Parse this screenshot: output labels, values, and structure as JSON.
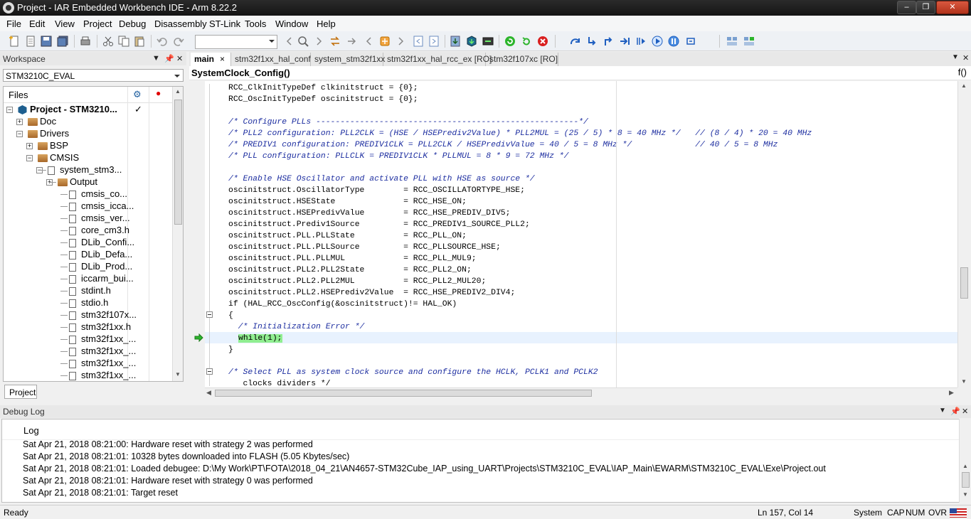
{
  "window": {
    "title": "Project - IAR Embedded Workbench IDE - Arm 8.22.2",
    "min": "–",
    "max": "❐",
    "close": "✕"
  },
  "menu": [
    "File",
    "Edit",
    "View",
    "Project",
    "Debug",
    "Disassembly",
    "ST-Link",
    "Tools",
    "Window",
    "Help"
  ],
  "toolbar": {
    "search_value": ""
  },
  "workspace": {
    "title": "Workspace",
    "config": "STM3210C_EVAL",
    "files_header": "Files",
    "tab": "Project",
    "tree": [
      {
        "label": "Project - STM3210...",
        "type": "project",
        "toggle": "−",
        "bold": true,
        "check": "✓"
      },
      {
        "label": "Doc",
        "type": "folder",
        "toggle": "+"
      },
      {
        "label": "Drivers",
        "type": "folder",
        "toggle": "−"
      },
      {
        "label": "BSP",
        "type": "folder",
        "toggle": "+"
      },
      {
        "label": "CMSIS",
        "type": "folder",
        "toggle": "−"
      },
      {
        "label": "system_stm3...",
        "type": "file",
        "toggle": "−"
      },
      {
        "label": "Output",
        "type": "folder",
        "toggle": "+"
      },
      {
        "label": "cmsis_co...",
        "type": "file"
      },
      {
        "label": "cmsis_icca...",
        "type": "file"
      },
      {
        "label": "cmsis_ver...",
        "type": "file"
      },
      {
        "label": "core_cm3.h",
        "type": "file"
      },
      {
        "label": "DLib_Confi...",
        "type": "file"
      },
      {
        "label": "DLib_Defa...",
        "type": "file"
      },
      {
        "label": "DLib_Prod...",
        "type": "file"
      },
      {
        "label": "iccarm_bui...",
        "type": "file"
      },
      {
        "label": "stdint.h",
        "type": "file"
      },
      {
        "label": "stdio.h",
        "type": "file"
      },
      {
        "label": "stm32f107x...",
        "type": "file"
      },
      {
        "label": "stm32f1xx.h",
        "type": "file"
      },
      {
        "label": "stm32f1xx_...",
        "type": "file"
      },
      {
        "label": "stm32f1xx_...",
        "type": "file"
      },
      {
        "label": "stm32f1xx_...",
        "type": "file"
      },
      {
        "label": "stm32f1xx_...",
        "type": "file"
      }
    ]
  },
  "editor": {
    "tabs": [
      "main",
      "stm32f1xx_hal_conf",
      "system_stm32f1xx",
      "stm32f1xx_hal_rcc_ex [RO]",
      "stm32f107xc [RO]"
    ],
    "tab_close": "×",
    "function": "SystemClock_Config()",
    "fx_icon": "f()",
    "lines": [
      "RCC_ClkInitTypeDef clkinitstruct = {0};",
      "RCC_OscInitTypeDef oscinitstruct = {0};",
      "",
      "/* Configure PLLs ------------------------------------------------------*/",
      "/* PLL2 configuration: PLL2CLK = (HSE / HSEPrediv2Value) * PLL2MUL = (25 / 5) * 8 = 40 MHz */   // (8 / 4) * 20 = 40 MHz",
      "/* PREDIV1 configuration: PREDIV1CLK = PLL2CLK / HSEPredivValue = 40 / 5 = 8 MHz */             // 40 / 5 = 8 MHz",
      "/* PLL configuration: PLLCLK = PREDIV1CLK * PLLMUL = 8 * 9 = 72 MHz */",
      "",
      "/* Enable HSE Oscillator and activate PLL with HSE as source */",
      "oscinitstruct.OscillatorType        = RCC_OSCILLATORTYPE_HSE;",
      "oscinitstruct.HSEState              = RCC_HSE_ON;",
      "oscinitstruct.HSEPredivValue        = RCC_HSE_PREDIV_DIV5;",
      "oscinitstruct.Prediv1Source         = RCC_PREDIV1_SOURCE_PLL2;",
      "oscinitstruct.PLL.PLLState          = RCC_PLL_ON;",
      "oscinitstruct.PLL.PLLSource         = RCC_PLLSOURCE_HSE;",
      "oscinitstruct.PLL.PLLMUL            = RCC_PLL_MUL9;",
      "oscinitstruct.PLL2.PLL2State        = RCC_PLL2_ON;",
      "oscinitstruct.PLL2.PLL2MUL          = RCC_PLL2_MUL20;",
      "oscinitstruct.PLL2.HSEPrediv2Value  = RCC_HSE_PREDIV2_DIV4;",
      "if (HAL_RCC_OscConfig(&oscinitstruct)!= HAL_OK)",
      "{",
      "  /* Initialization Error */",
      "  while(1);",
      "}",
      "",
      "/* Select PLL as system clock source and configure the HCLK, PCLK1 and PCLK2",
      "   clocks dividers */"
    ],
    "current_line_index": 22
  },
  "debug_log": {
    "title": "Debug Log",
    "header": "Log",
    "entries": [
      "Sat Apr 21, 2018 08:21:00: Hardware reset with strategy 2 was performed",
      "Sat Apr 21, 2018 08:21:01: 10328 bytes downloaded into FLASH (5.05 Kbytes/sec)",
      "Sat Apr 21, 2018 08:21:01: Loaded debugee: D:\\My Work\\PT\\FOTA\\2018_04_21\\AN4657-STM32Cube_IAP_using_UART\\Projects\\STM3210C_EVAL\\IAP_Main\\EWARM\\STM3210C_EVAL\\Exe\\Project.out",
      "Sat Apr 21, 2018 08:21:01: Hardware reset with strategy 0 was performed",
      "Sat Apr 21, 2018 08:21:01: Target reset"
    ]
  },
  "status": {
    "left": "Ready",
    "position": "Ln 157, Col 14",
    "system": "System",
    "cap": "CAP",
    "num": "NUM",
    "ovr": "OVR"
  },
  "colors": {
    "comment": "#1d2ea0",
    "highlight": "#90ee90",
    "arrow": "#2db52d"
  }
}
